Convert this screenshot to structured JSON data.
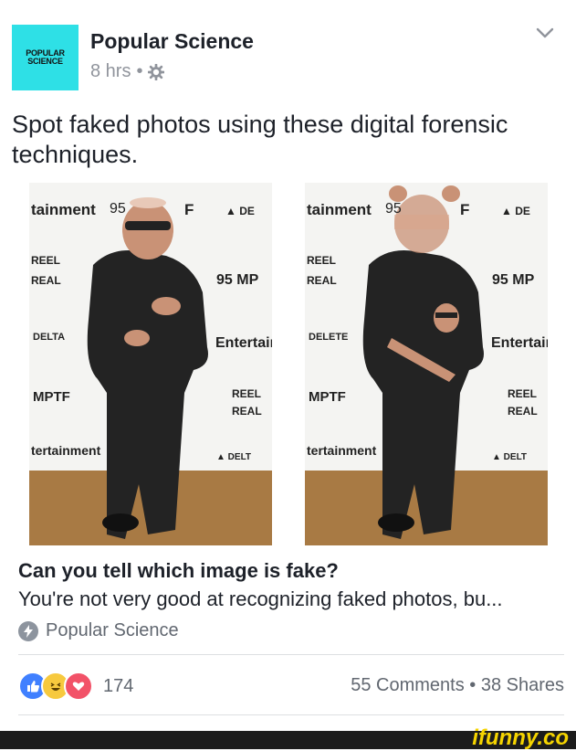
{
  "post": {
    "logo_line1": "POPULAR",
    "logo_line2": "SCIENCE",
    "page_name": "Popular Science",
    "time": "8 hrs",
    "meta_dot": "•",
    "text": "Spot faked photos using these digital forensic techniques."
  },
  "photos": {
    "left_backdrop": [
      "tainment",
      "95",
      "F",
      "▲ DE",
      "REEL",
      "REAL",
      "95 MP",
      "DELTA",
      "Entertainn",
      "MPTF",
      "REEL",
      "REAL",
      "tertainment",
      "▲ DELT"
    ],
    "right_backdrop": [
      "tainment",
      "95",
      "F",
      "▲ DE",
      "REEL",
      "REAL",
      "95 MP",
      "DELETE",
      "Entertainn",
      "MPTF",
      "REEL",
      "REAL",
      "tertainment",
      "▲ DELT"
    ]
  },
  "link": {
    "title": "Can you tell which image is fake?",
    "description": "You're not very good at recognizing faked photos, bu...",
    "source": "Popular Science"
  },
  "engagement": {
    "reaction_count": "174",
    "comments_shares": "55 Comments • 38 Shares"
  },
  "watermark": "ifunny.co",
  "colors": {
    "logo_bg": "#2ee0e6",
    "like_blue": "#4080ff",
    "haha_yellow": "#f7c93e",
    "love_red": "#f25268",
    "watermark_yellow": "#f5d400"
  },
  "icons": [
    "gear-icon",
    "chevron-down-icon",
    "bolt-icon",
    "like-reaction-icon",
    "haha-reaction-icon",
    "love-reaction-icon"
  ]
}
